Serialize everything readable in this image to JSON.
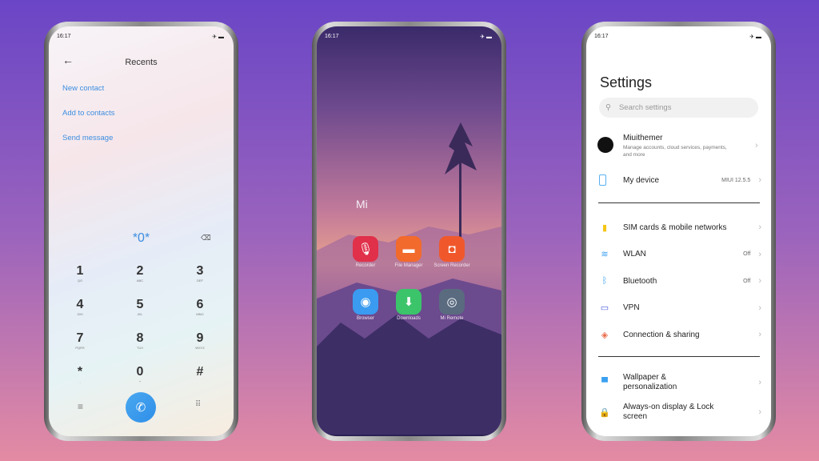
{
  "status_time": "16:17",
  "dialer": {
    "title": "Recents",
    "links": [
      "New contact",
      "Add to contacts",
      "Send message"
    ],
    "input": "*0*",
    "keys": [
      {
        "d": "1",
        "l": "QO"
      },
      {
        "d": "2",
        "l": "ABC"
      },
      {
        "d": "3",
        "l": "DEF"
      },
      {
        "d": "4",
        "l": "GHI"
      },
      {
        "d": "5",
        "l": "JKL"
      },
      {
        "d": "6",
        "l": "MNO"
      },
      {
        "d": "7",
        "l": "PQRS"
      },
      {
        "d": "8",
        "l": "TUV"
      },
      {
        "d": "9",
        "l": "WXYZ"
      },
      {
        "d": "*",
        "l": ","
      },
      {
        "d": "0",
        "l": "+"
      },
      {
        "d": "#",
        "l": ""
      }
    ],
    "accent": "#3d9be9"
  },
  "home": {
    "folder": "Mi",
    "apps": [
      {
        "label": "Recorder",
        "color": "#e0304a",
        "icon": "microphone-icon"
      },
      {
        "label": "File Manager",
        "color": "#f26a2c",
        "icon": "folder-icon"
      },
      {
        "label": "Screen Recorder",
        "color": "#f0582c",
        "icon": "video-camera-icon"
      },
      {
        "label": "Browser",
        "color": "#3a9bf0",
        "icon": "globe-icon"
      },
      {
        "label": "Downloads",
        "color": "#3cc46a",
        "icon": "download-icon"
      },
      {
        "label": "Mi Remote",
        "color": "#5a6b80",
        "icon": "remote-icon"
      }
    ]
  },
  "settings": {
    "title": "Settings",
    "search_placeholder": "Search settings",
    "account": {
      "name": "Miuithemer",
      "desc": "Manage accounts, cloud services, payments, and more"
    },
    "device": {
      "label": "My device",
      "value": "MIUI 12.5.5"
    },
    "items": [
      {
        "label": "SIM cards & mobile networks",
        "value": "",
        "color": "#f5c518"
      },
      {
        "label": "WLAN",
        "value": "Off",
        "color": "#3aa0f0"
      },
      {
        "label": "Bluetooth",
        "value": "Off",
        "color": "#3aa0f0"
      },
      {
        "label": "VPN",
        "value": "",
        "color": "#4a5ae0"
      },
      {
        "label": "Connection & sharing",
        "value": "",
        "color": "#e86a4a"
      }
    ],
    "items2": [
      {
        "label": "Wallpaper & personalization",
        "color": "#3aa0f0"
      },
      {
        "label": "Always-on display & Lock screen",
        "color": "#ee5a50"
      }
    ]
  }
}
